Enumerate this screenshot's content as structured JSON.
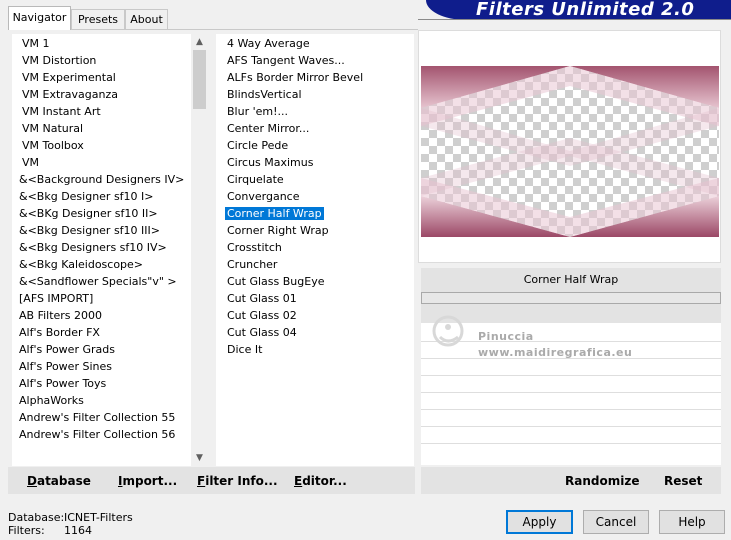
{
  "tabs": [
    {
      "label": "Navigator",
      "active": true
    },
    {
      "label": "Presets",
      "active": false
    },
    {
      "label": "About",
      "active": false
    }
  ],
  "banner_title": "Filters Unlimited 2.0",
  "categories": [
    "VM 1",
    "VM Distortion",
    "VM Experimental",
    "VM Extravaganza",
    "VM Instant Art",
    "VM Natural",
    "VM Toolbox",
    "VM",
    "&<Background Designers IV>",
    "&<Bkg Designer sf10 I>",
    "&<BKg Designer sf10 II>",
    "&<Bkg Designer sf10 III>",
    "&<Bkg Designers sf10 IV>",
    "&<Bkg Kaleidoscope>",
    "&<Sandflower Specials\"v\" >",
    "[AFS IMPORT]",
    "AB Filters 2000",
    "Alf's Border FX",
    "Alf's Power Grads",
    "Alf's Power Sines",
    "Alf's Power Toys",
    "AlphaWorks",
    "Andrew's Filter Collection 55",
    "Andrew's Filter Collection 56"
  ],
  "filters": [
    "4 Way Average",
    "AFS Tangent Waves...",
    "ALFs Border Mirror Bevel",
    "BlindsVertical",
    "Blur 'em!...",
    "Center Mirror...",
    "Circle Pede",
    "Circus Maximus",
    "Cirquelate",
    "Convergance",
    "Corner Half Wrap",
    "Corner Right Wrap",
    "Crosstitch",
    "Cruncher",
    "Cut Glass  BugEye",
    "Cut Glass 01",
    "Cut Glass 02",
    "Cut Glass 04",
    "Dice It"
  ],
  "selected_filter_index": 10,
  "current_filter_name": "Corner Half Wrap",
  "watermark": {
    "line1": "Pinuccia",
    "line2": "www.maidiregrafica.eu"
  },
  "bottom_buttons": {
    "database": {
      "first": "D",
      "rest": "atabase"
    },
    "import": {
      "first": "I",
      "rest": "mport..."
    },
    "filter_info": {
      "first": "F",
      "rest": "ilter Info..."
    },
    "editor": {
      "first": "E",
      "rest": "ditor..."
    },
    "randomize": "Randomize",
    "reset": "Reset"
  },
  "footer": {
    "database_label": "Database:",
    "database_value": "ICNET-Filters",
    "filters_label": "Filters:",
    "filters_value": "1164"
  },
  "dialog_buttons": {
    "apply": "Apply",
    "cancel": "Cancel",
    "help": "Help"
  },
  "colors": {
    "banner": "#0f1d8c",
    "selection": "#0078d7",
    "preview_pink": "#b05a78"
  }
}
